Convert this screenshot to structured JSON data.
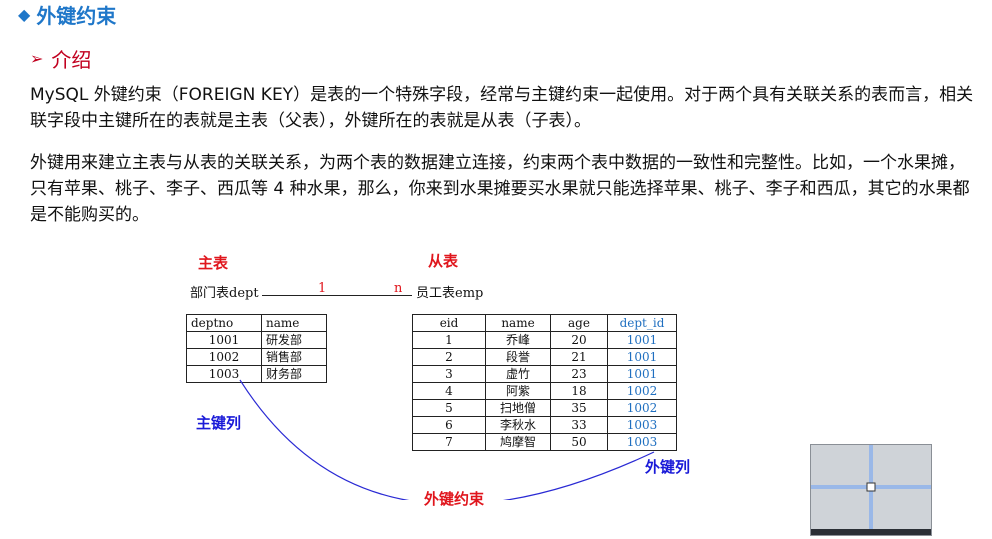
{
  "header": {
    "section_title": "外键约束",
    "subtitle": "介绍"
  },
  "paragraphs": {
    "p1": "MySQL 外键约束（FOREIGN KEY）是表的一个特殊字段，经常与主键约束一起使用。对于两个具有关联关系的表而言，相关联字段中主键所在的表就是主表（父表），外键所在的表就是从表（子表）。",
    "p2": "外键用来建立主表与从表的关联关系，为两个表的数据建立连接，约束两个表中数据的一致性和完整性。比如，一个水果摊，只有苹果、桃子、李子、西瓜等 4 种水果，那么，你来到水果摊要买水果就只能选择苹果、桃子、李子和西瓜，其它的水果都是不能购买的。"
  },
  "diagram": {
    "master_label": "主表",
    "slave_label": "从表",
    "relation": {
      "left": "部门表dept",
      "one": "1",
      "many": "n",
      "right": "员工表emp"
    },
    "pk_label": "主键列",
    "fk_label": "外键列",
    "constraint_label": "外键约束",
    "colors": {
      "red": "#e0151c",
      "blue": "#1a1ad8",
      "fk_value": "#1f6fc0"
    },
    "dept": {
      "headers": [
        "deptno",
        "name"
      ],
      "rows": [
        [
          "1001",
          "研发部"
        ],
        [
          "1002",
          "销售部"
        ],
        [
          "1003",
          "财务部"
        ]
      ]
    },
    "emp": {
      "headers": [
        "eid",
        "name",
        "age",
        "dept_id"
      ],
      "rows": [
        [
          "1",
          "乔峰",
          "20",
          "1001"
        ],
        [
          "2",
          "段誉",
          "21",
          "1001"
        ],
        [
          "3",
          "虚竹",
          "23",
          "1001"
        ],
        [
          "4",
          "阿紫",
          "18",
          "1002"
        ],
        [
          "5",
          "扫地僧",
          "35",
          "1002"
        ],
        [
          "6",
          "李秋水",
          "33",
          "1003"
        ],
        [
          "7",
          "鸠摩智",
          "50",
          "1003"
        ]
      ]
    }
  },
  "icons": {
    "section_marker": "diamond-icon",
    "subtitle_marker": "arrow-right-icon"
  }
}
